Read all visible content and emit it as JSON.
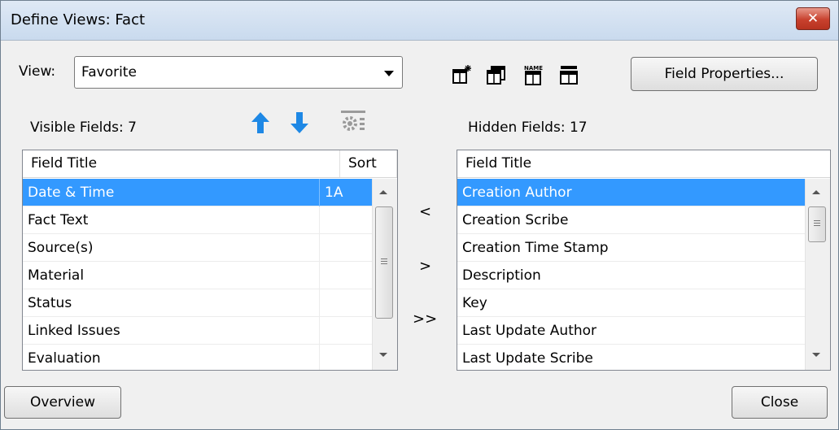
{
  "window": {
    "title": "Define Views: Fact",
    "close_glyph": "✕"
  },
  "view": {
    "label": "View:",
    "value": "Favorite"
  },
  "toolbar": {
    "icons": [
      "new-view-icon",
      "copy-view-icon",
      "rename-view-icon",
      "delete-view-icon"
    ],
    "field_properties_label": "Field Properties..."
  },
  "visible": {
    "label": "Visible Fields: 7",
    "columns": [
      "Field Title",
      "Sort"
    ],
    "rows": [
      {
        "title": "Date & Time",
        "sort": "1A"
      },
      {
        "title": "Fact Text",
        "sort": ""
      },
      {
        "title": "Source(s)",
        "sort": ""
      },
      {
        "title": "Material",
        "sort": ""
      },
      {
        "title": "Status",
        "sort": ""
      },
      {
        "title": "Linked Issues",
        "sort": ""
      },
      {
        "title": "Evaluation",
        "sort": ""
      }
    ]
  },
  "hidden": {
    "label": "Hidden Fields: 17",
    "columns": [
      "Field Title"
    ],
    "rows": [
      "Creation Author",
      "Creation Scribe",
      "Creation Time Stamp",
      "Description",
      "Key",
      "Last Update Author",
      "Last Update Scribe"
    ]
  },
  "move": {
    "show_label": "<",
    "hide_label": ">",
    "hide_all_label": ">>"
  },
  "footer": {
    "overview_label": "Overview",
    "close_label": "Close"
  },
  "colors": {
    "selection": "#3399ff",
    "arrow_blue": "#1e88e5"
  }
}
